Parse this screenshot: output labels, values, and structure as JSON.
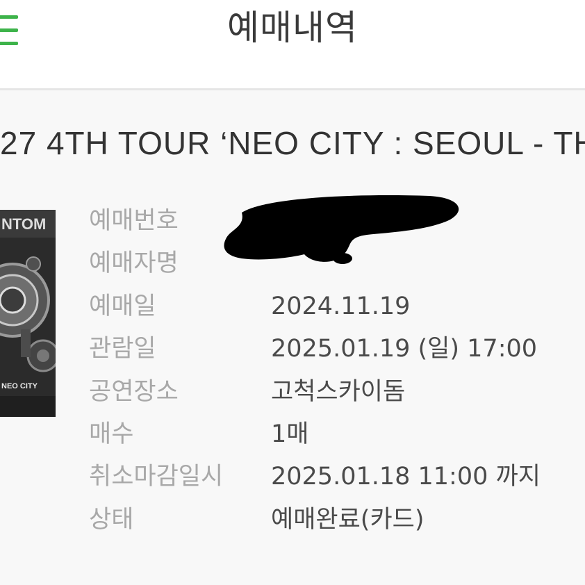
{
  "header": {
    "title": "예매내역",
    "menu_icon": "hamburger-menu-icon",
    "accent_color": "#3db34a"
  },
  "event": {
    "title": "27 4TH TOUR ‘NEO CITY : SEOUL - TH"
  },
  "poster": {
    "caption": "NEO CITY",
    "top_text": "NTOM"
  },
  "details": [
    {
      "label": "예매번호",
      "value": ""
    },
    {
      "label": "예매자명",
      "value": ""
    },
    {
      "label": "예매일",
      "value": "2024.11.19"
    },
    {
      "label": "관람일",
      "value": "2025.01.19 (일) 17:00"
    },
    {
      "label": "공연장소",
      "value": "고척스카이돔"
    },
    {
      "label": "매수",
      "value": "1매"
    },
    {
      "label": "취소마감일시",
      "value": "2025.01.18 11:00 까지"
    },
    {
      "label": "상태",
      "value": "예매완료(카드)"
    }
  ]
}
